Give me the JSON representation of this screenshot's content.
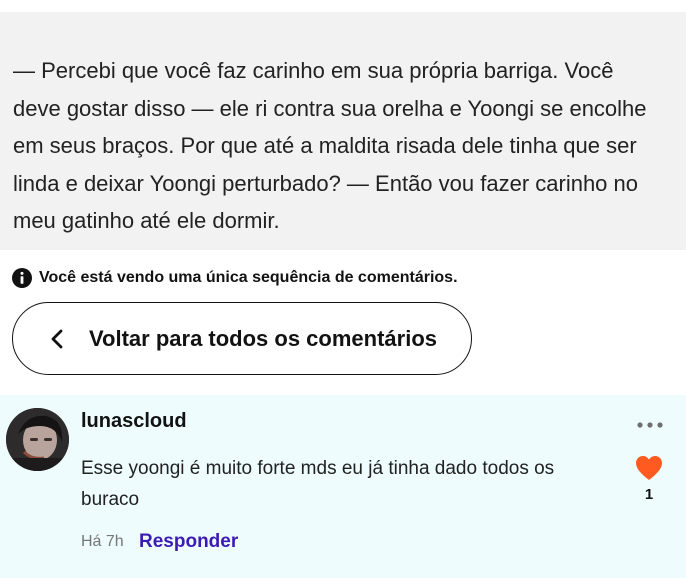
{
  "quote": {
    "text": "— Percebi que você faz carinho em sua própria barriga. Você deve gostar disso — ele ri contra sua orelha e Yoongi se encolhe em seus braços. Por que até a maldita risada dele tinha que ser linda e deixar Yoongi perturbado? — Então vou fazer carinho no meu gatinho até ele dormir."
  },
  "notice": {
    "icon": "info-icon",
    "text": "Você está vendo uma única sequência de comentários."
  },
  "back_button": {
    "icon": "chevron-left-icon",
    "label": "Voltar para todos os comentários"
  },
  "comment": {
    "username": "lunascloud",
    "text": "Esse yoongi é muito forte mds eu já tinha dado todos os buraco",
    "like_count": "1",
    "timestamp": "Há 7h",
    "reply_label": "Responder",
    "liked_color": "#ff5a1f",
    "background": "#eefcfd"
  },
  "colors": {
    "quote_background": "#f2f2f2",
    "reply_link": "#3d1bb3"
  }
}
